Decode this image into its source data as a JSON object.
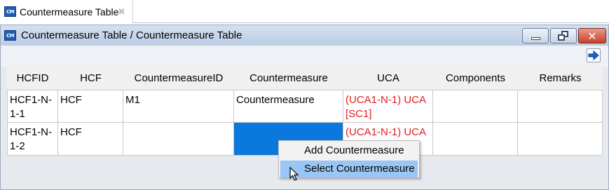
{
  "tab": {
    "label": "Countermeasure Table",
    "close": "✖"
  },
  "window": {
    "title": "Countermeasure Table / Countermeasure Table"
  },
  "app_icon_text": "CM",
  "table": {
    "headers": [
      "HCFID",
      "HCF",
      "CountermeasureID",
      "Countermeasure",
      "UCA",
      "Components",
      "Remarks"
    ],
    "rows": [
      {
        "hcfid": "HCF1-N-1-1",
        "hcf": "HCF",
        "countermeasure_id": "M1",
        "countermeasure": "Countermeasure",
        "uca": "(UCA1-N-1) UCA [SC1]",
        "components": "",
        "remarks": ""
      },
      {
        "hcfid": "HCF1-N-1-2",
        "hcf": "HCF",
        "countermeasure_id": "",
        "countermeasure": "",
        "uca": "(UCA1-N-1) UCA",
        "components": "",
        "remarks": ""
      }
    ]
  },
  "context_menu": {
    "items": [
      "Add Countermeasure",
      "Select Countermeasure"
    ],
    "highlighted": "Select Countermeasure"
  },
  "colors": {
    "uca_text": "#dd1f1f",
    "selected_cell": "#0a78dc",
    "menu_highlight": "#99c6f5",
    "titlebar": "#c8d7ea"
  },
  "icons": {
    "export": "export-arrow-icon",
    "minimize": "minimize-icon",
    "maximize": "restore-icon",
    "close": "close-icon"
  }
}
